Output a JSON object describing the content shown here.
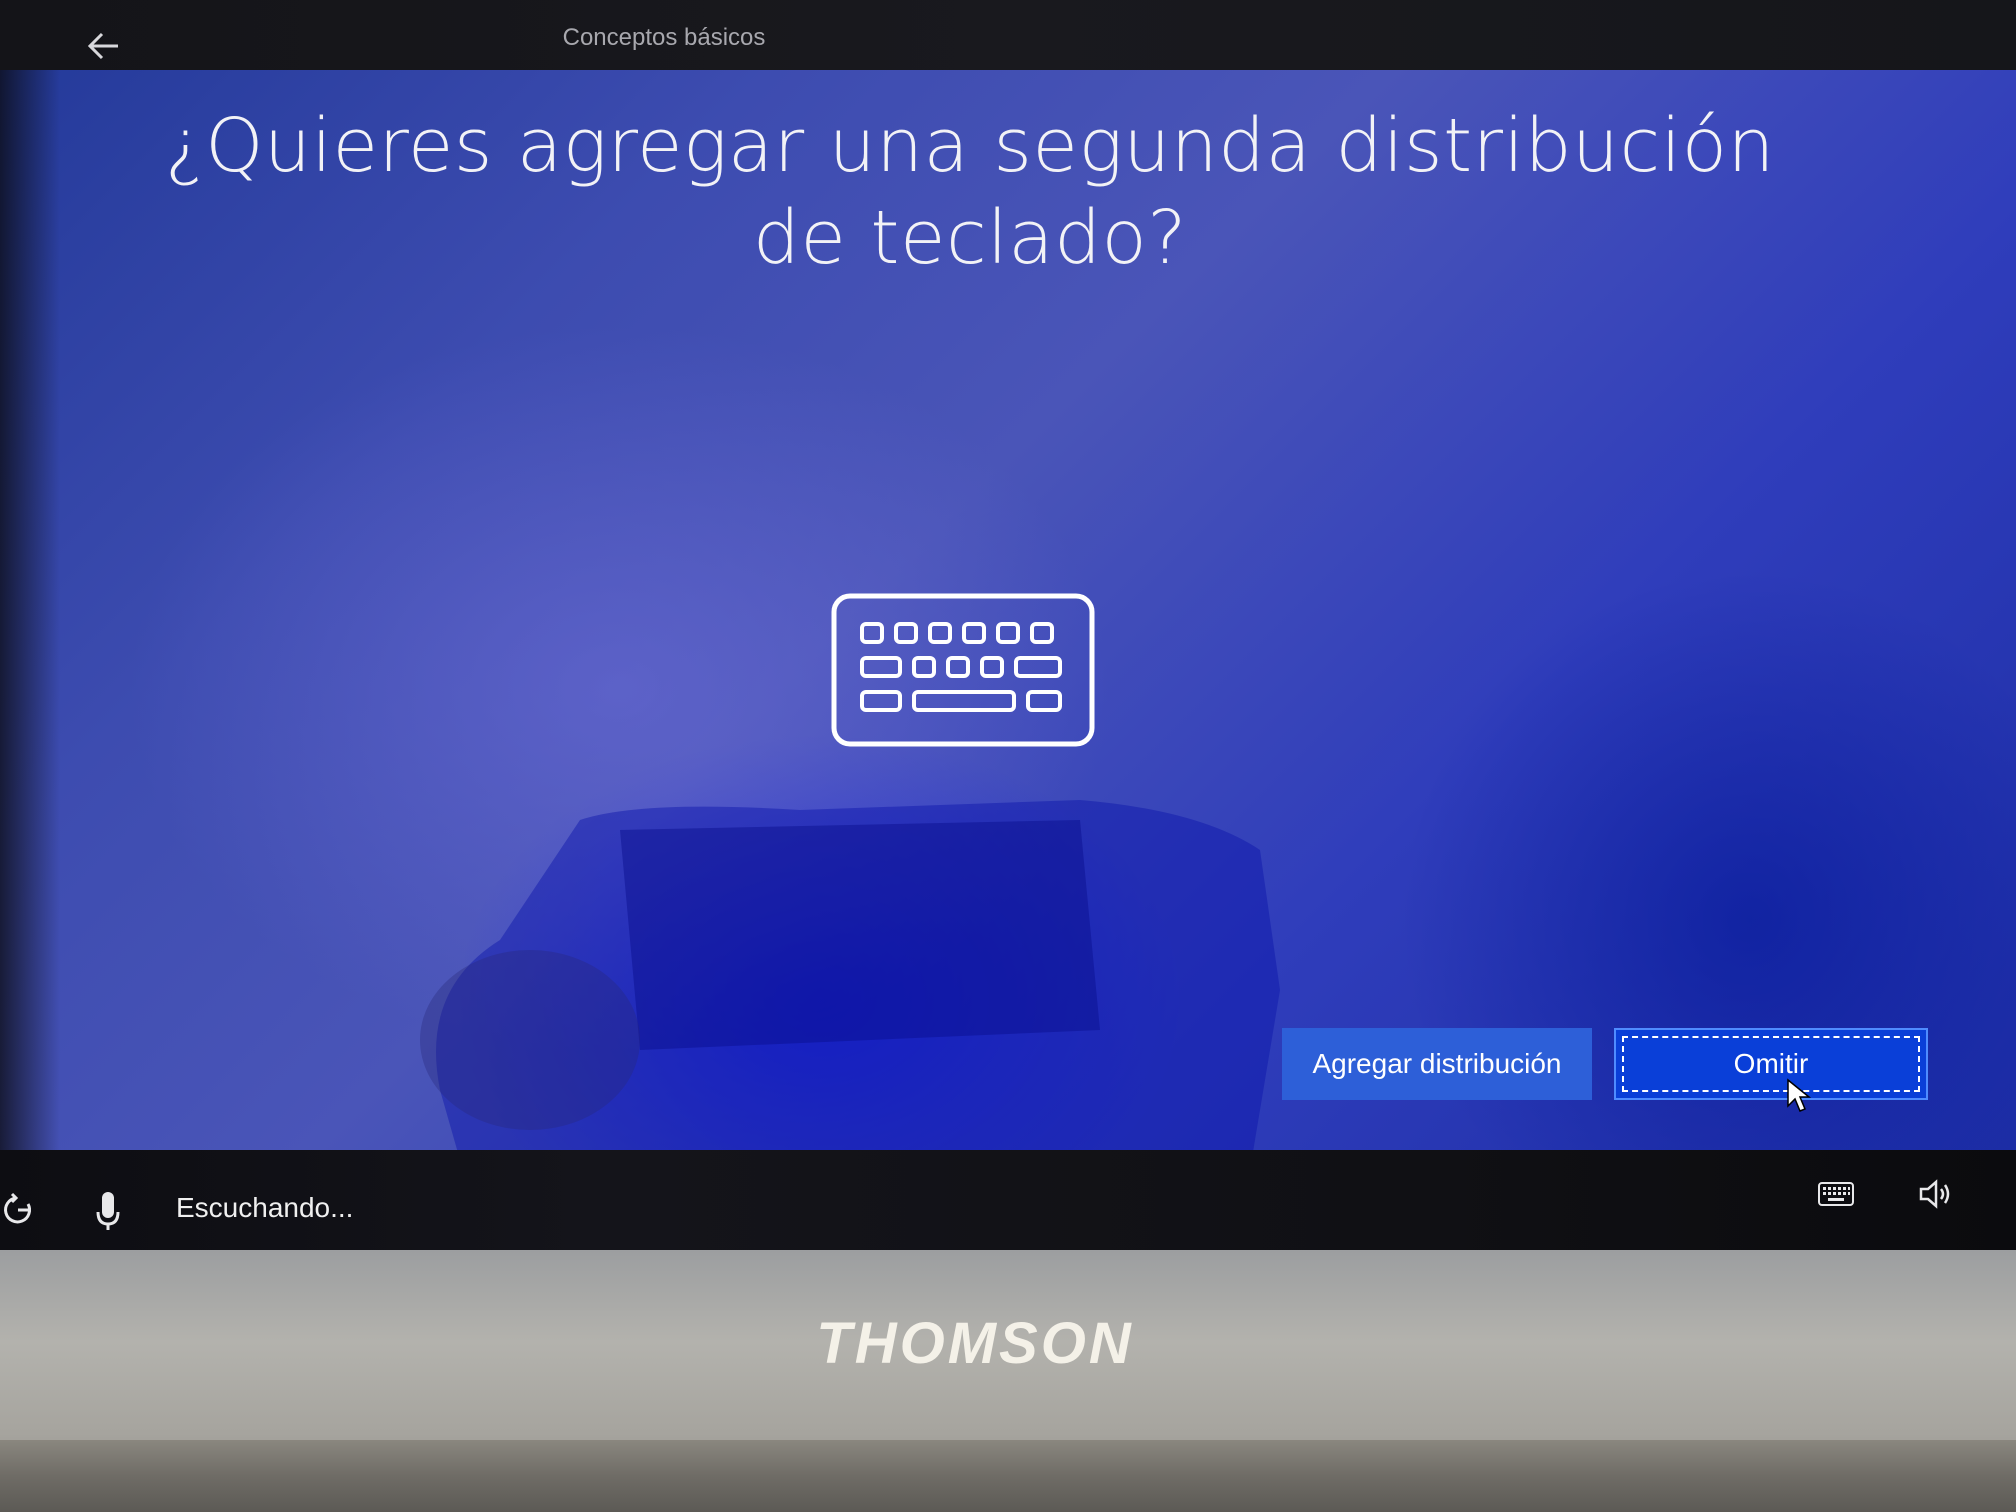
{
  "header": {
    "tab_label": "Conceptos básicos"
  },
  "main": {
    "title": "¿Quieres agregar una segunda distribución de teclado?",
    "illustration_icon": "keyboard-icon"
  },
  "actions": {
    "add_label": "Agregar distribución",
    "skip_label": "Omitir"
  },
  "statusbar": {
    "listening_text": "Escuchando...",
    "icons": [
      "accessibility-icon",
      "microphone-icon",
      "keyboard-icon",
      "volume-icon"
    ]
  },
  "device": {
    "brand": "THOMSON"
  },
  "colors": {
    "screen_blue": "#3d4cb0",
    "button_add": "#2d5fd8",
    "button_skip": "#0a3fd8",
    "text": "#f2f2f6"
  }
}
